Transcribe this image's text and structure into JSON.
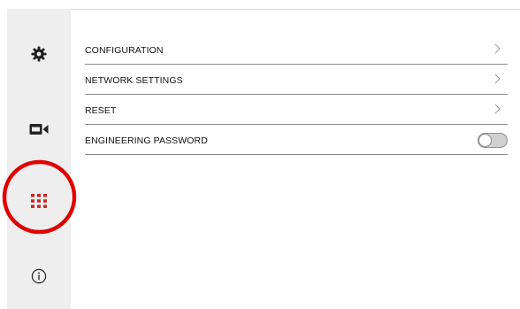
{
  "sidebar": {
    "items": [
      {
        "name": "settings",
        "icon": "gear-icon"
      },
      {
        "name": "camera",
        "icon": "video-camera-icon"
      },
      {
        "name": "apps",
        "icon": "grid-icon",
        "color": "#cc2222"
      },
      {
        "name": "info",
        "icon": "info-icon"
      }
    ]
  },
  "menu": {
    "items": [
      {
        "label": "CONFIGURATION",
        "control": "chevron"
      },
      {
        "label": "NETWORK SETTINGS",
        "control": "chevron"
      },
      {
        "label": "RESET",
        "control": "chevron"
      },
      {
        "label": "ENGINEERING PASSWORD",
        "control": "toggle",
        "toggle_on": false
      }
    ]
  },
  "annotation": {
    "highlight_color": "#e00000",
    "target": "apps"
  }
}
